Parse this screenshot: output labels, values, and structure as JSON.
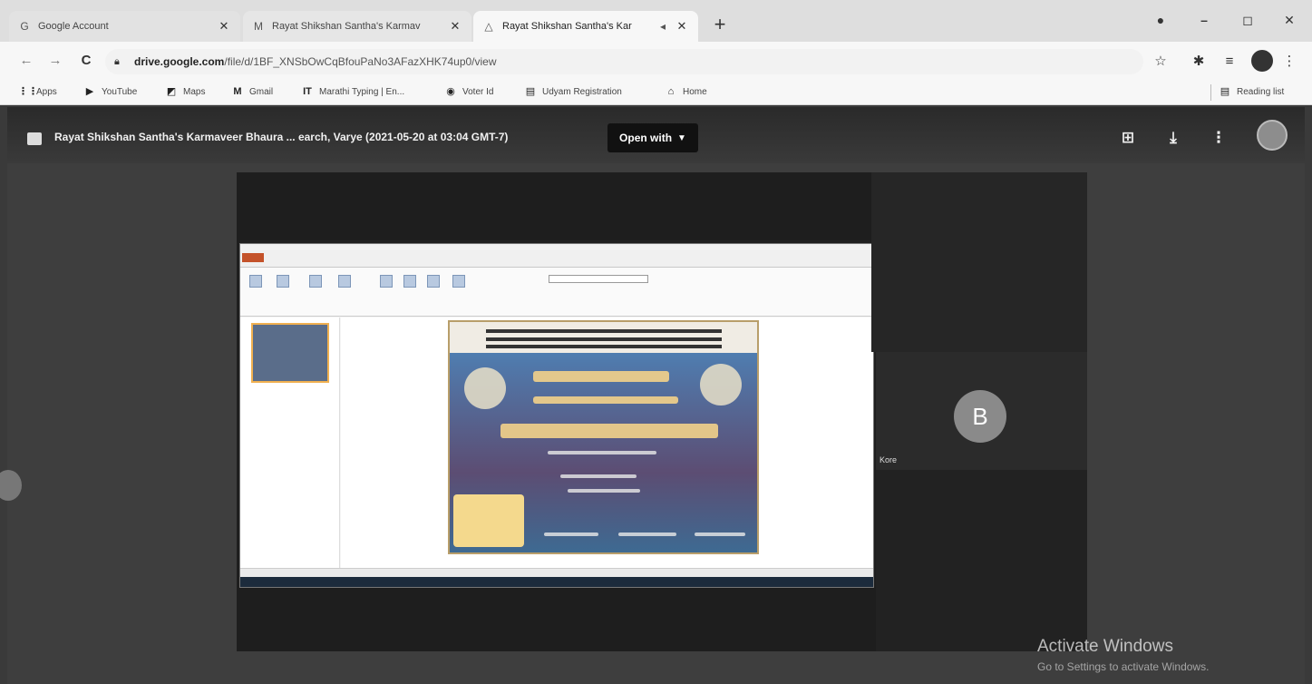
{
  "tabs": [
    {
      "icon": "google-icon",
      "title": "Google Account",
      "close": "✕"
    },
    {
      "icon": "gmail-icon",
      "title": "Rayat Shikshan Santha's Karmav",
      "close": "✕"
    },
    {
      "icon": "drive-icon",
      "title": "Rayat Shikshan Santha's Kar",
      "close": "✕",
      "active": true
    }
  ],
  "new_tab": "+",
  "window_controls": {
    "minimize": "–",
    "restore": "◻",
    "close": "✕"
  },
  "toolbar": {
    "url_host": "drive.google.com",
    "url_path": "/file/d/1BF_XNSbOwCqBfouPaNo3AFazXHK74up0/view"
  },
  "bookmarks": [
    {
      "icon": "apps-icon",
      "label": "Apps"
    },
    {
      "icon": "youtube-icon",
      "label": "YouTube"
    },
    {
      "icon": "maps-icon",
      "label": "Maps"
    },
    {
      "icon": "gmail-icon",
      "label": "Gmail"
    },
    {
      "icon": "typing-icon",
      "label": "Marathi Typing | En..."
    },
    {
      "icon": "voter-icon",
      "label": "Voter Id"
    },
    {
      "icon": "udyam-icon",
      "label": "Udyam Registration"
    },
    {
      "icon": "home-icon",
      "label": "Home"
    }
  ],
  "reading_list": "Reading list",
  "viewer": {
    "title": "Rayat Shikshan Santha's Karmaveer Bhaura ... earch, Varye (2021-05-20 at 03:04 GMT-7)",
    "open_with": "Open with"
  },
  "participant": {
    "initial": "B",
    "name": "Kore"
  },
  "watermark": {
    "title": "Activate Windows",
    "subtitle": "Go to Settings to activate Windows."
  }
}
